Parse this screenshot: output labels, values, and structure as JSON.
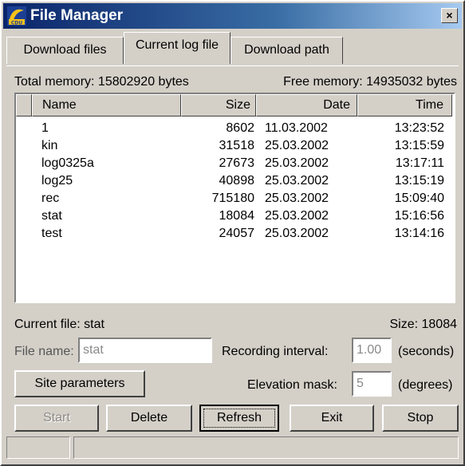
{
  "window": {
    "title": "File Manager",
    "icon": "cdu-app-icon",
    "close": "×"
  },
  "tabs": [
    {
      "label": "Download files",
      "active": false
    },
    {
      "label": "Current log file",
      "active": true
    },
    {
      "label": "Download path",
      "active": false
    }
  ],
  "memory": {
    "total": "Total memory: 15802920 bytes",
    "free": "Free memory: 14935032 bytes"
  },
  "list": {
    "columns": [
      "Name",
      "Size",
      "Date",
      "Time"
    ],
    "rows": [
      {
        "name": "1",
        "size": "8602",
        "date": "11.03.2002",
        "time": "13:23:52"
      },
      {
        "name": "kin",
        "size": "31518",
        "date": "25.03.2002",
        "time": "13:15:59"
      },
      {
        "name": "log0325a",
        "size": "27673",
        "date": "25.03.2002",
        "time": "13:17:11"
      },
      {
        "name": "log25",
        "size": "40898",
        "date": "25.03.2002",
        "time": "13:15:19"
      },
      {
        "name": "rec",
        "size": "715180",
        "date": "25.03.2002",
        "time": "15:09:40"
      },
      {
        "name": "stat",
        "size": "18084",
        "date": "25.03.2002",
        "time": "15:16:56"
      },
      {
        "name": "test",
        "size": "24057",
        "date": "25.03.2002",
        "time": "13:14:16"
      }
    ]
  },
  "current": {
    "file": "Current file: stat",
    "size": "Size: 18084"
  },
  "form": {
    "file_name_label": "File name:",
    "file_name_value": "stat",
    "interval_label": "Recording interval:",
    "interval_value": "1.00",
    "interval_unit": "(seconds)",
    "elevation_label": "Elevation mask:",
    "elevation_value": "5",
    "elevation_unit": "(degrees)",
    "site_parameters": "Site parameters"
  },
  "buttons": {
    "start": "Start",
    "delete": "Delete",
    "refresh": "Refresh",
    "exit": "Exit",
    "stop": "Stop"
  },
  "colors": {
    "titlebar": "#0a246a",
    "face": "#d4d0c8"
  }
}
